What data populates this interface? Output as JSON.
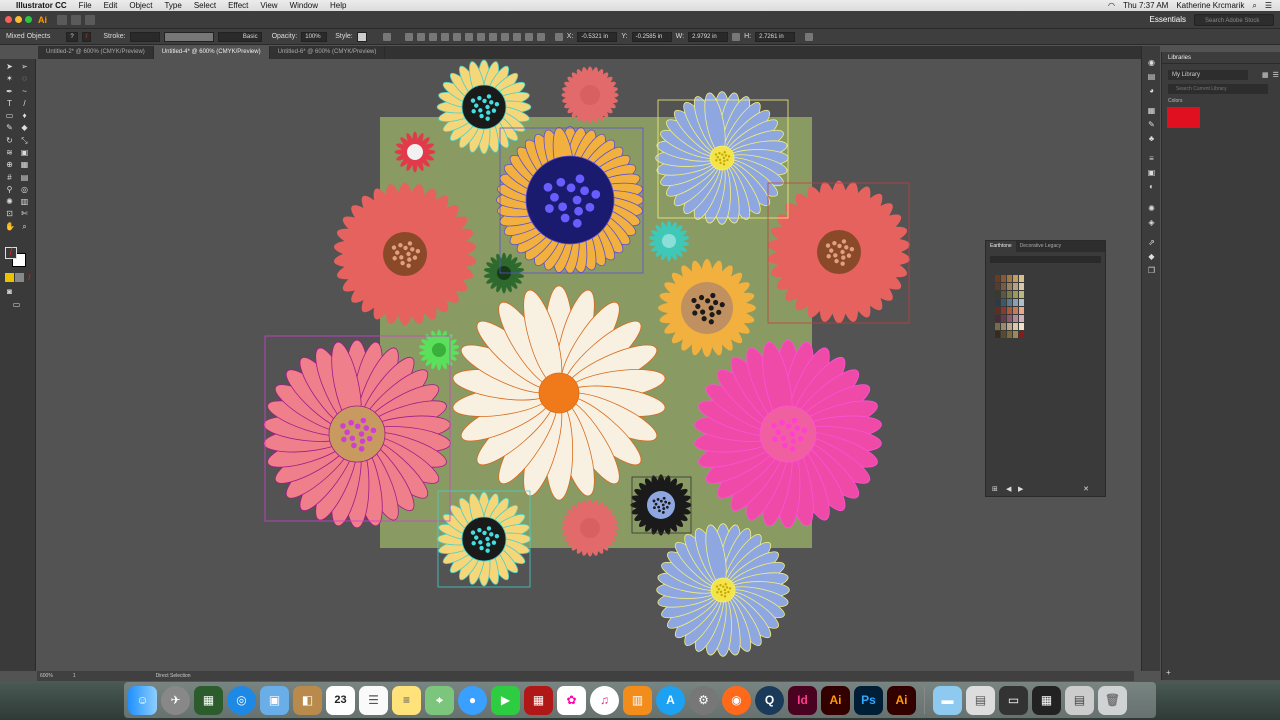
{
  "menubar": {
    "app_name": "Illustrator CC",
    "items": [
      "File",
      "Edit",
      "Object",
      "Type",
      "Select",
      "Effect",
      "View",
      "Window",
      "Help"
    ],
    "clock": "Thu 7:37 AM",
    "user": "Katherine Krcmarik"
  },
  "appbar": {
    "logo": "Ai",
    "workspace": "Essentials",
    "stock_search_placeholder": "Search Adobe Stock"
  },
  "control": {
    "selection_label": "Mixed Objects",
    "stroke_label": "Stroke:",
    "brush_label": "Basic",
    "opacity_label": "Opacity:",
    "opacity_value": "100%",
    "style_label": "Style:",
    "x_value": "-0.5321 in",
    "y_value": "-0.2585 in",
    "w_value": "2.9792 in",
    "h_value": "2.7261 in"
  },
  "tabs": [
    "Untitled-2* @ 600% (CMYK/Preview)",
    "Untitled-4* @ 600% (CMYK/Preview)",
    "Untitled-6* @ 600% (CMYK/Preview)"
  ],
  "libraries": {
    "title": "Libraries",
    "library": "My Library",
    "search_placeholder": "Search Current Library",
    "colors_label": "Colors",
    "swatch_color": "#e01020"
  },
  "swatch_panel": {
    "tab1": "Earthtone",
    "tab2": "Decorative Legacy"
  },
  "status": {
    "zoom": "600%",
    "page": "1",
    "tool": "Direct Selection"
  },
  "dock": {
    "calendar_day": "23",
    "apps": [
      "Id",
      "Ai",
      "Ps",
      "Ai"
    ]
  },
  "colors": {
    "artboard": "#8a9a63",
    "accent_orange": "#ff9a00"
  }
}
